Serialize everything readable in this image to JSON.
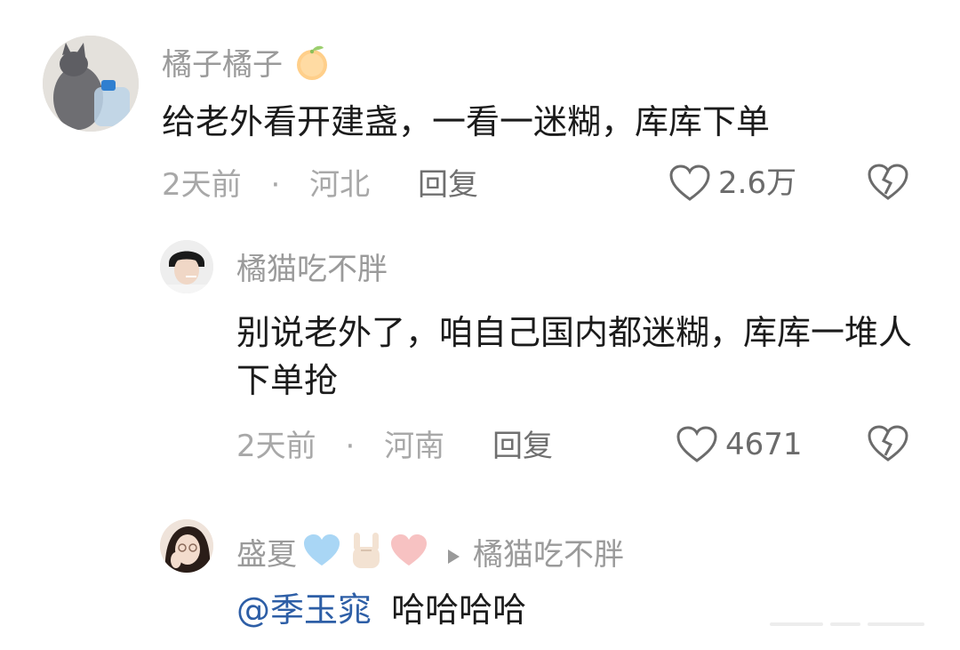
{
  "comments": [
    {
      "author": "橘子橘子",
      "author_emoji": "tangerine-emoji",
      "text": "给老外看开建盏，一看一迷糊，库库下单",
      "time": "2天前",
      "separator": "·",
      "location": "河北",
      "reply_label": "回复",
      "like_count": "2.6万"
    },
    {
      "author": "橘猫吃不胖",
      "text": "别说老外了，咱自己国内都迷糊，库库一堆人下单抢",
      "time": "2天前",
      "separator": "·",
      "location": "河南",
      "reply_label": "回复",
      "like_count": "4671"
    },
    {
      "author": "盛夏",
      "author_emojis": [
        "light-blue-heart-emoji",
        "rock-hand-emoji",
        "pink-heart-emoji"
      ],
      "reply_to": "橘猫吃不胖",
      "mention": "@季玉窕",
      "text": "哈哈哈哈"
    }
  ],
  "colors": {
    "name": "#9a9a9a",
    "text": "#1b1b1b",
    "meta": "#a8a8a8",
    "mention": "#2d5ea6"
  }
}
